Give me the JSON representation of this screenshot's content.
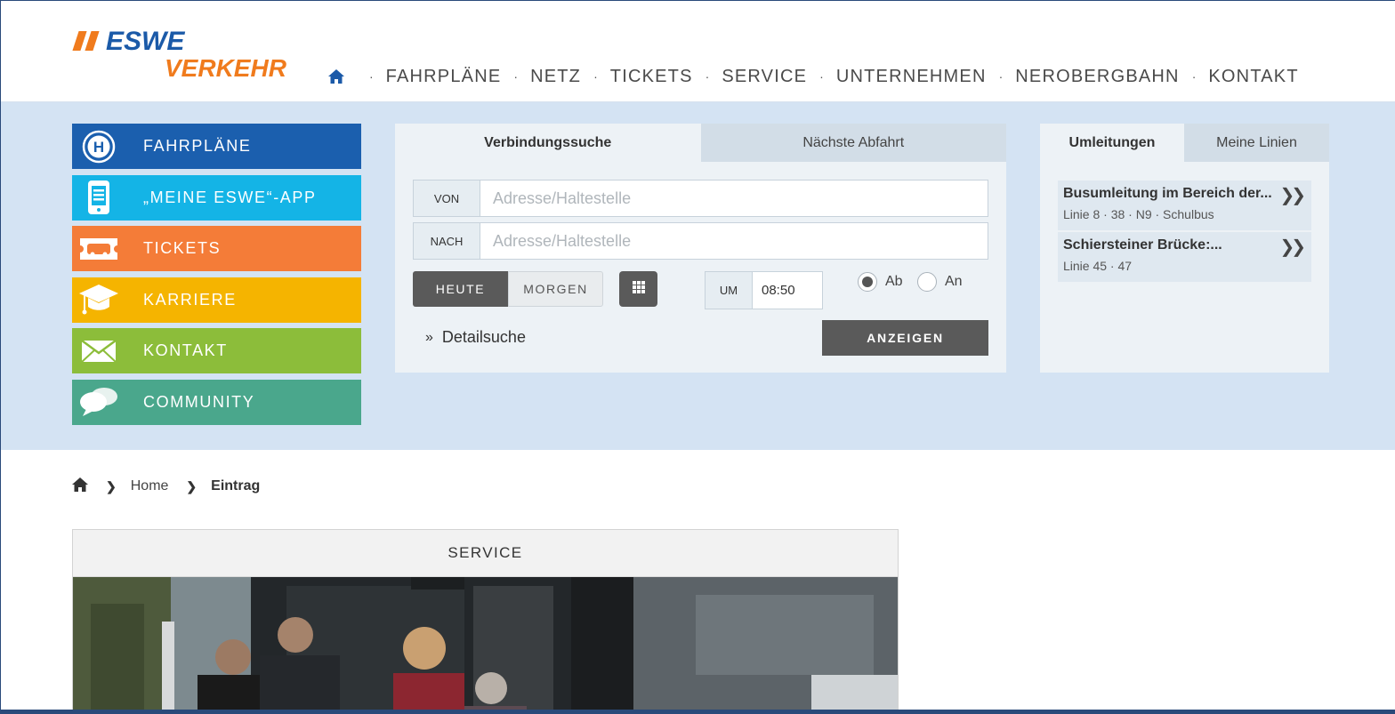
{
  "logo": {
    "line1": "ESWE",
    "line2": "VERKEHR"
  },
  "nav": {
    "home_icon": "home-icon",
    "items": [
      "FAHRPLÄNE",
      "NETZ",
      "TICKETS",
      "SERVICE",
      "UNTERNEHMEN",
      "NEROBERGBAHN",
      "KONTAKT"
    ]
  },
  "quicklinks": [
    {
      "label": "FAHRPLÄNE",
      "icon": "bus-stop-icon",
      "color": "#1b5fae"
    },
    {
      "label": "„MEINE ESWE“-APP",
      "icon": "smartphone-icon",
      "color": "#14b4e6"
    },
    {
      "label": "TICKETS",
      "icon": "ticket-icon",
      "color": "#f47c38"
    },
    {
      "label": "KARRIERE",
      "icon": "graduation-cap-icon",
      "color": "#f5b400"
    },
    {
      "label": "KONTAKT",
      "icon": "envelope-icon",
      "color": "#8cbd3a"
    },
    {
      "label": "COMMUNITY",
      "icon": "speech-bubbles-icon",
      "color": "#4aa78c"
    }
  ],
  "search": {
    "tabs": [
      "Verbindungssuche",
      "Nächste Abfahrt"
    ],
    "from_label": "VON",
    "from_placeholder": "Adresse/Haltestelle",
    "from_value": "",
    "to_label": "NACH",
    "to_placeholder": "Adresse/Haltestelle",
    "to_value": "",
    "day_today": "HEUTE",
    "day_tomorrow": "MORGEN",
    "time_label": "UM",
    "time_value": "08:50",
    "radio_departure": "Ab",
    "radio_arrival": "An",
    "detail_link": "Detailsuche",
    "submit_label": "ANZEIGEN"
  },
  "detours": {
    "tabs": [
      "Umleitungen",
      "Meine Linien"
    ],
    "items": [
      {
        "title": "Busumleitung im Bereich der...",
        "lines": "Linie 8 · 38 · N9 · Schulbus"
      },
      {
        "title": "Schiersteiner Brücke:...",
        "lines": "Linie 45 · 47"
      }
    ]
  },
  "breadcrumb": {
    "home": "Home",
    "current": "Eintrag"
  },
  "card": {
    "heading": "SERVICE"
  },
  "colors": {
    "brand_blue": "#1b5aa8",
    "brand_orange": "#f07b1d",
    "band_bg": "#d4e3f3",
    "button_dark": "#5a5a5a"
  }
}
